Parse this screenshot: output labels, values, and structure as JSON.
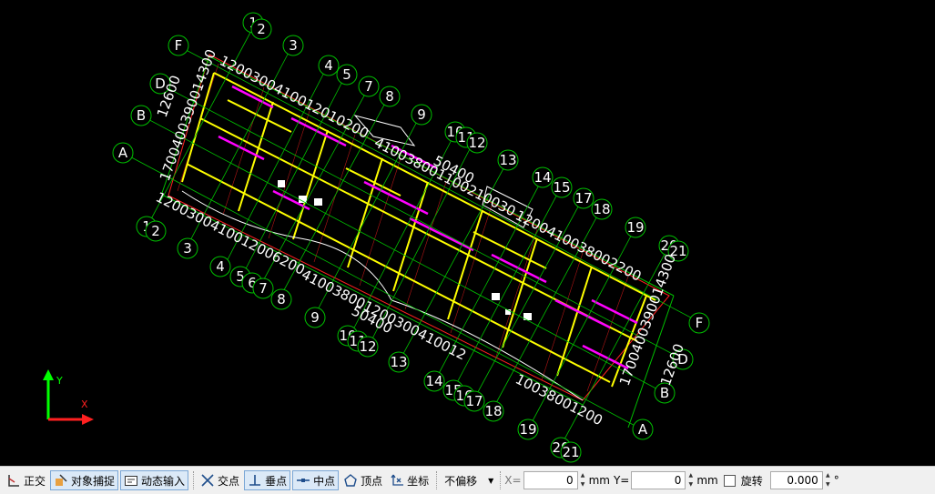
{
  "drawing": {
    "grid_numbers_top": [
      "1",
      "2",
      "3",
      "4",
      "5",
      "7",
      "8",
      "9",
      "10",
      "11",
      "12",
      "13",
      "14",
      "15",
      "17",
      "18",
      "19",
      "20",
      "21"
    ],
    "grid_numbers_bottom": [
      "1",
      "2",
      "3",
      "4",
      "5",
      "6",
      "7",
      "8",
      "9",
      "10",
      "11",
      "12",
      "13",
      "14",
      "15",
      "16",
      "17",
      "18",
      "19",
      "20",
      "21"
    ],
    "grid_letters_left": [
      "F",
      "D",
      "B",
      "A"
    ],
    "grid_letters_right": [
      "F",
      "D",
      "B",
      "A"
    ],
    "dimension_total": "50400",
    "dimension_side": "12600",
    "dim_string_top_a": "1200300410012010200",
    "dim_string_top_b": "410038001100210030",
    "dim_string_top_c": "1200410038002200",
    "dim_string_bottom_a": "1200300410012006200",
    "dim_string_bottom_b": "410038001200300410012",
    "dim_string_bottom_c": "10038001200",
    "dim_left_stack": "1700400390014300",
    "dim_right_stack": "1700400390014300",
    "colors": {
      "grid": "#00c000",
      "wall": "#ffff00",
      "beam": "#ff00ff",
      "red": "#ff2020",
      "white": "#ffffff"
    }
  },
  "ucs": {
    "x_label": "X",
    "y_label": "Y"
  },
  "statusbar": {
    "ortho": "正交",
    "osnap": "对象捕捉",
    "dyn_input": "动态输入",
    "intersection": "交点",
    "perpendicular": "垂点",
    "midpoint": "中点",
    "vertex": "顶点",
    "coordinate": "坐标",
    "offset_mode": "不偏移",
    "x_label": "X=",
    "x_value": "0",
    "mm_x": "mm",
    "y_label": "Y=",
    "y_value": "0",
    "mm_y": "mm",
    "rotate_label": "旋转",
    "rotate_value": "0.000",
    "degree": "°"
  }
}
